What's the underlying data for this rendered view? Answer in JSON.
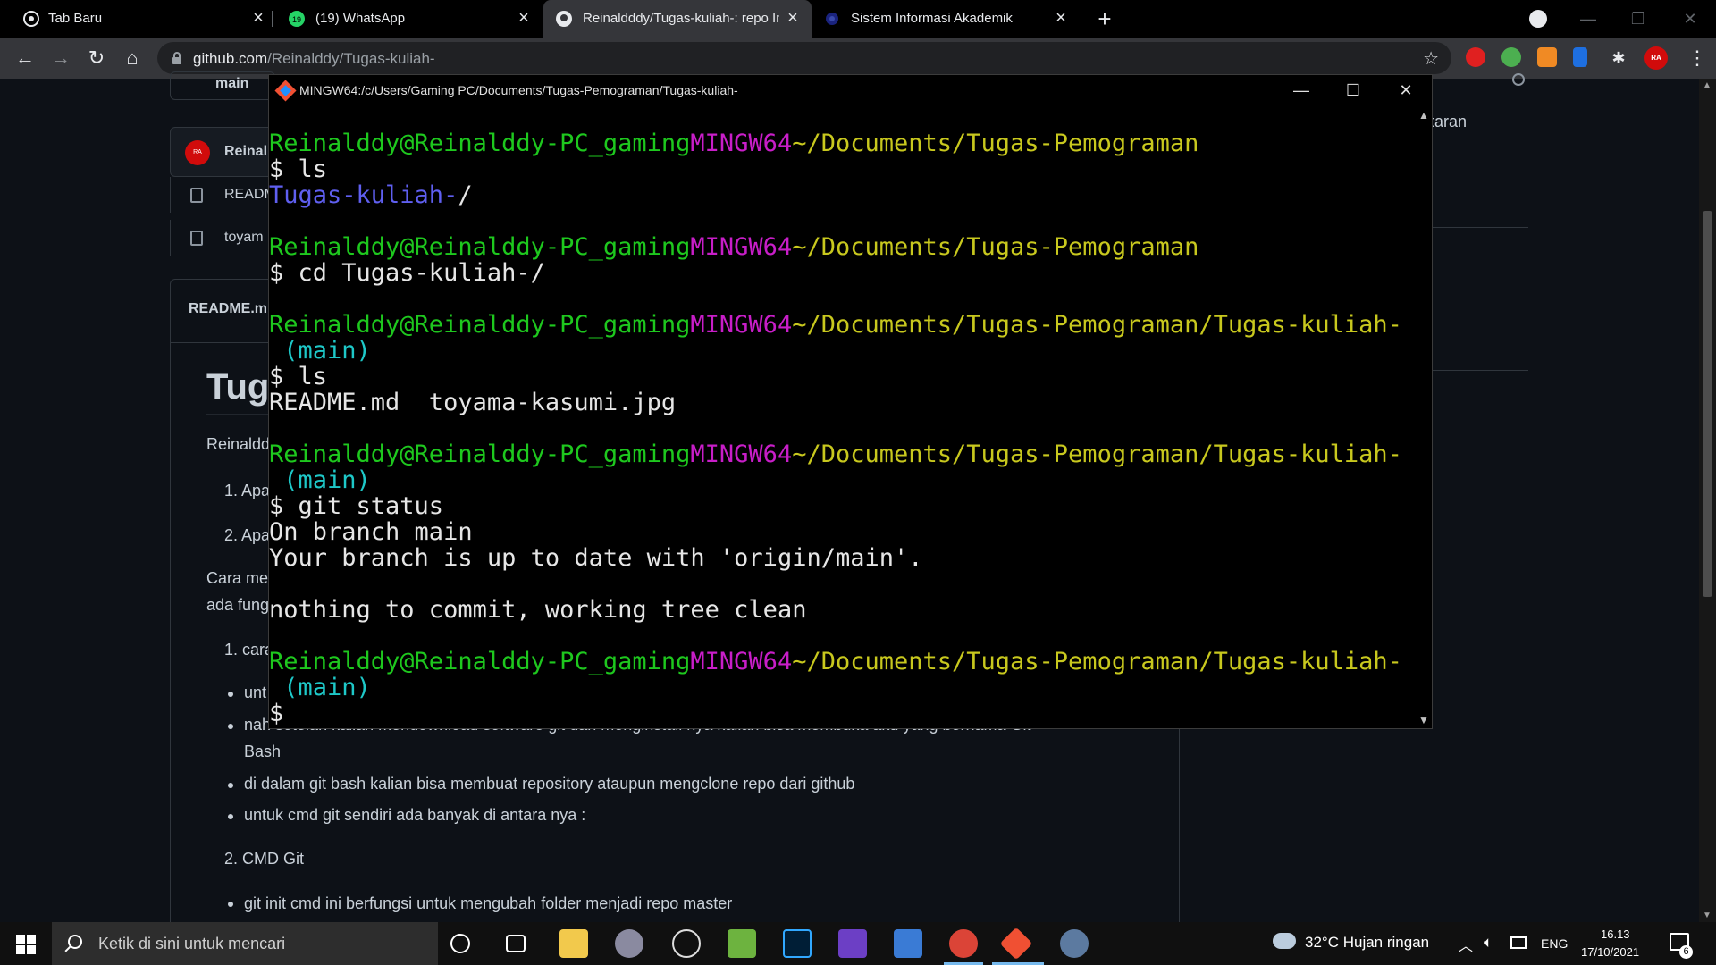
{
  "browser": {
    "tabs": [
      {
        "title": "Tab Baru",
        "active": false
      },
      {
        "title": "(19) WhatsApp",
        "active": false,
        "badge": "19"
      },
      {
        "title": "Reinaldddy/Tugas-kuliah-: repo Ini",
        "active": true
      },
      {
        "title": "Sistem Informasi Akademik",
        "active": false
      }
    ],
    "url_host": "github.com",
    "url_path": "/Reinalddy/Tugas-kuliah-",
    "colors": {
      "tab_strip": "#000000",
      "toolbar": "#35363a",
      "omnibox": "#202124"
    }
  },
  "github": {
    "branch": "main",
    "commit_author": "Reinal",
    "avatar_text": "RA",
    "files": [
      "READM",
      "toyam"
    ],
    "readme_header": "README.m",
    "heading": "Tug",
    "sidebar_text": "eputaran",
    "lines": [
      "Reinaldd",
      "1. Apa",
      "2. Apa",
      "Cara me",
      "ada fung",
      "1. cara",
      "unt",
      "nah setelah kalian mendownload software git dan menginstall nya kalian bisa membuka aku yang bernama Git",
      "Bash",
      "di dalam git bash kalian bisa membuat repository ataupun mengclone repo dari github",
      "untuk cmd git sendiri ada banyak di antara nya :",
      "2. CMD Git",
      "git init cmd ini berfungsi untuk mengubah folder menjadi repo master"
    ]
  },
  "terminal": {
    "title": "MINGW64:/c/Users/Gaming PC/Documents/Tugas-Pemograman/Tugas-kuliah-",
    "user": "Reinalddy@Reinalddy-PC_gaming",
    "env": "MINGW64",
    "branch_tag": " (main)",
    "path_parent": "~/Documents/Tugas-Pemograman",
    "path_repo": "~/Documents/Tugas-Pemograman/Tugas-kuliah-",
    "cmd_ls": "$ ls",
    "out_dir": "Tugas-kuliah-",
    "out_dir_slash": "/",
    "cmd_cd": "$ cd Tugas-kuliah-/",
    "out_files": "README.md  toyama-kasumi.jpg",
    "cmd_status": "$ git status",
    "status_1": "On branch main",
    "status_2": "Your branch is up to date with 'origin/main'.",
    "status_3": "nothing to commit, working tree clean",
    "prompt": "$",
    "colors": {
      "user": "#1ec81e",
      "env": "#c81ec8",
      "path": "#c8c81e",
      "branch": "#1ec8c8",
      "dir": "#5f5ff0"
    }
  },
  "taskbar": {
    "search_placeholder": "Ketik di sini untuk mencari",
    "weather": "32°C  Hujan ringan",
    "lang": "ENG",
    "time": "16.13",
    "date": "17/10/2021",
    "notifications": "6"
  }
}
